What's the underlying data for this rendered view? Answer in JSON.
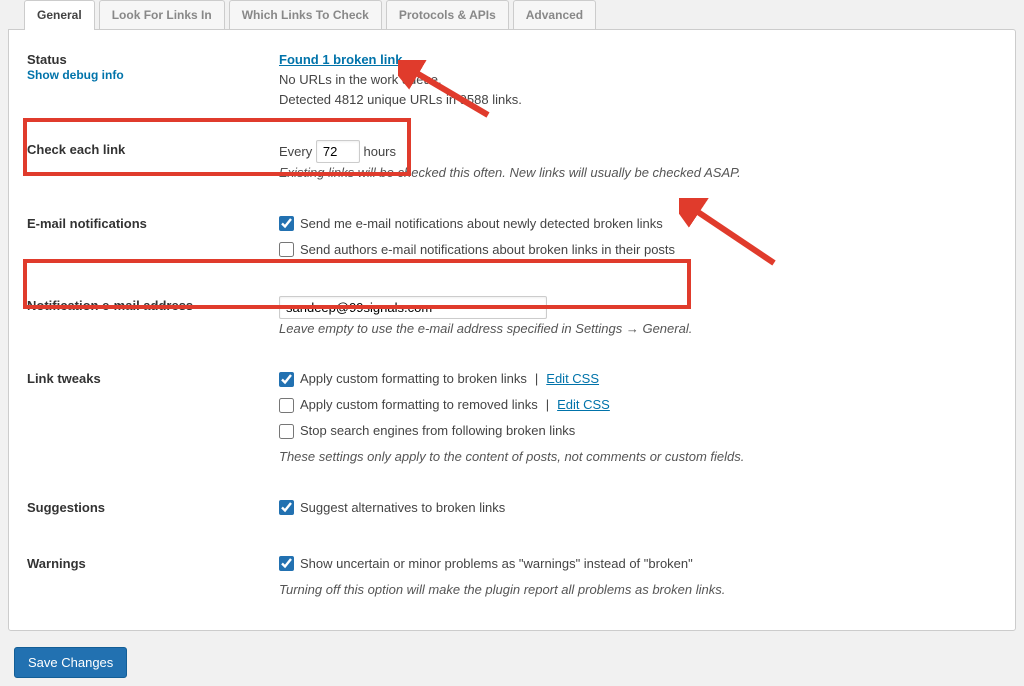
{
  "tabs": {
    "general": "General",
    "look_for": "Look For Links In",
    "which": "Which Links To Check",
    "protocols": "Protocols & APIs",
    "advanced": "Advanced"
  },
  "status": {
    "label": "Status",
    "debug_link": "Show debug info",
    "found_link": "Found 1 broken link",
    "queue_msg": "No URLs in the work queue.",
    "detected_msg": "Detected 4812 unique URLs in 9588 links."
  },
  "check_each": {
    "label": "Check each link",
    "every": "Every",
    "hours": "hours",
    "value": "72",
    "note": "Existing links will be checked this often. New links will usually be checked ASAP."
  },
  "email_notif": {
    "label": "E-mail notifications",
    "opt1": "Send me e-mail notifications about newly detected broken links",
    "opt2": "Send authors e-mail notifications about broken links in their posts"
  },
  "notif_addr": {
    "label": "Notification e-mail address",
    "value": "sandeep@99signals.com",
    "note": "Leave empty to use the e-mail address specified in Settings → General."
  },
  "tweaks": {
    "label": "Link tweaks",
    "opt1": "Apply custom formatting to broken links",
    "opt2": "Apply custom formatting to removed links",
    "opt3": "Stop search engines from following broken links",
    "edit_css": "Edit CSS",
    "note": "These settings only apply to the content of posts, not comments or custom fields."
  },
  "suggestions": {
    "label": "Suggestions",
    "opt1": "Suggest alternatives to broken links"
  },
  "warnings": {
    "label": "Warnings",
    "opt1": "Show uncertain or minor problems as \"warnings\" instead of \"broken\"",
    "note": "Turning off this option will make the plugin report all problems as broken links."
  },
  "save_btn": "Save Changes"
}
